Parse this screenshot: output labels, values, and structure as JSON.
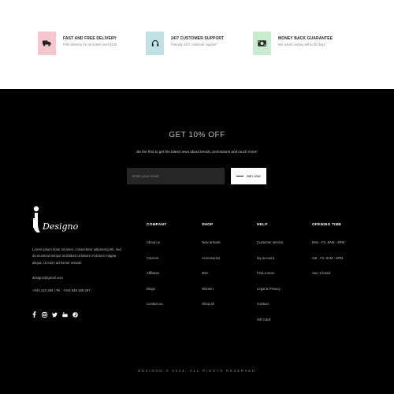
{
  "features": [
    {
      "icon": "truck-icon",
      "color": "#f4c7cf",
      "title": "FAST AND FREE DELIVERY",
      "desc": "Free delivery for all orders over $140"
    },
    {
      "icon": "headphones-icon",
      "color": "#bfe3e4",
      "title": "24/7 CUSTOMER SUPPORT",
      "desc": "Friendly 24/7 customer support"
    },
    {
      "icon": "money-icon",
      "color": "#c9eccf",
      "title": "MONEY BACK GUARANTEE",
      "desc": "We return money within 30 days"
    }
  ],
  "newsletter": {
    "title": "GET 10% OFF",
    "desc": "Be the first to get the latest news about trends, promotions and much more!",
    "placeholder": "Enter your email",
    "button": "Join now"
  },
  "brand": {
    "name": "Designo",
    "about": "Lorem ipsum dolor sit amet, consectetur adipiscing elit, sed do eiusmod tempor incididunt ut labore et dolore magna aliqua. Ut enim ad minim veniam.",
    "email": "designo@gmail.com",
    "phones": "+044 123 289  |  Tel : +044 548 189 287",
    "socials": [
      "facebook-icon",
      "instagram-icon",
      "twitter-icon",
      "youtube-icon",
      "pinterest-icon"
    ]
  },
  "columns": [
    {
      "title": "COMPANY",
      "links": [
        "About us",
        "Careers",
        "Affiliates",
        "Blogs",
        "Contact us"
      ]
    },
    {
      "title": "SHOP",
      "links": [
        "New arrivals",
        "Accessories",
        "Men",
        "Women",
        "Shop all"
      ]
    },
    {
      "title": "HELP",
      "links": [
        "Customer service",
        "My account",
        "Find a store",
        "Legal & Privacy",
        "Contact",
        "Gift Card"
      ]
    },
    {
      "title": "OPENING TIME",
      "links": [
        "Mon - Fri, 8AM - 9PM",
        "Sat - Fri, 9AM - 8PM",
        "Sun, Closed"
      ]
    }
  ],
  "copyright": "DESIGNO © 2024. ALL RIGHTS RESERVED"
}
